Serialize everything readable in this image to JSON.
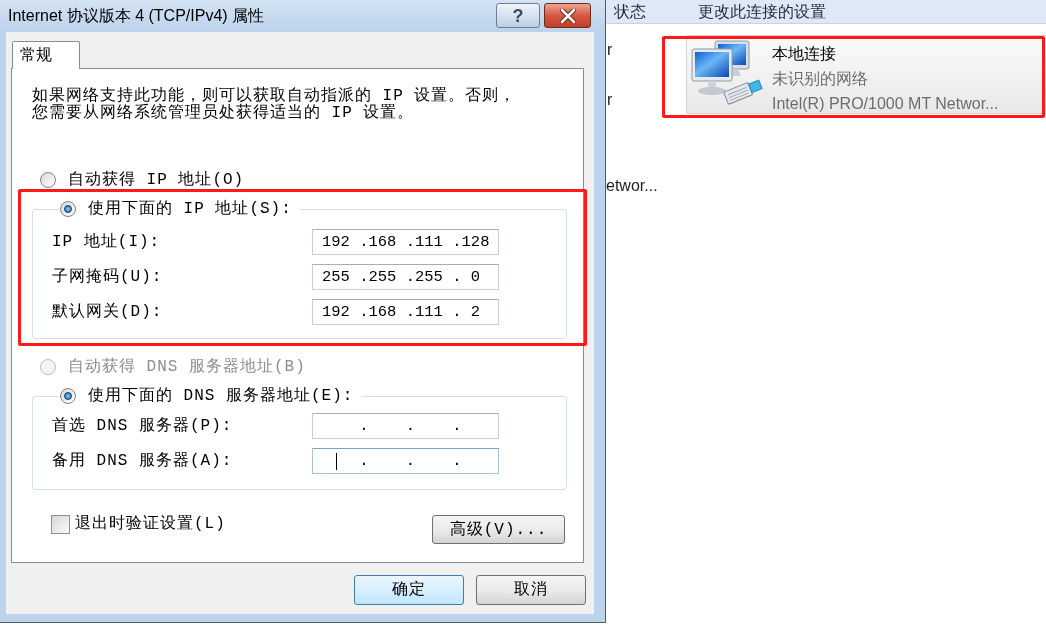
{
  "dialog": {
    "title": "Internet 协议版本 4 (TCP/IPv4) 属性",
    "help_button": "?",
    "tabs": [
      {
        "label": "常规",
        "selected": true
      }
    ],
    "description": "如果网络支持此功能，则可以获取自动指派的 IP 设置。否则，您需要从网络系统管理员处获得适当的 IP 设置。",
    "ip_options": [
      {
        "label": "自动获得 IP 地址(O)",
        "selected": false,
        "disabled": false
      },
      {
        "label": "使用下面的 IP 地址(S):",
        "selected": true,
        "disabled": false
      }
    ],
    "ip_fields": [
      {
        "label": "IP 地址(I):",
        "value": "192 .168 .111 .128",
        "focused": false
      },
      {
        "label": "子网掩码(U):",
        "value": "255 .255 .255 . 0",
        "focused": false
      },
      {
        "label": "默认网关(D):",
        "value": "192 .168 .111 . 2",
        "focused": false
      }
    ],
    "dns_options": [
      {
        "label": "自动获得 DNS 服务器地址(B)",
        "selected": false,
        "disabled": true
      },
      {
        "label": "使用下面的 DNS 服务器地址(E):",
        "selected": true,
        "disabled": false
      }
    ],
    "dns_fields": [
      {
        "label": "首选 DNS 服务器(P):",
        "value": "    .    .    .",
        "focused": false
      },
      {
        "label": "备用 DNS 服务器(A):",
        "value": "    .    .    .",
        "focused": true
      }
    ],
    "validate_checkbox": {
      "label": "退出时验证设置(L)",
      "checked": false
    },
    "advanced_button": "高级(V)...",
    "buttons": [
      {
        "label": "确定",
        "default": true
      },
      {
        "label": "取消",
        "default": false
      }
    ]
  },
  "background_window": {
    "toolbar": [
      "状态",
      "更改此连接的设置"
    ],
    "column_1": [
      "r",
      "r",
      "etwor..."
    ],
    "connection": {
      "name": "本地连接",
      "status": "未识别的网络",
      "device": "Intel(R) PRO/1000 MT Networ..."
    }
  }
}
